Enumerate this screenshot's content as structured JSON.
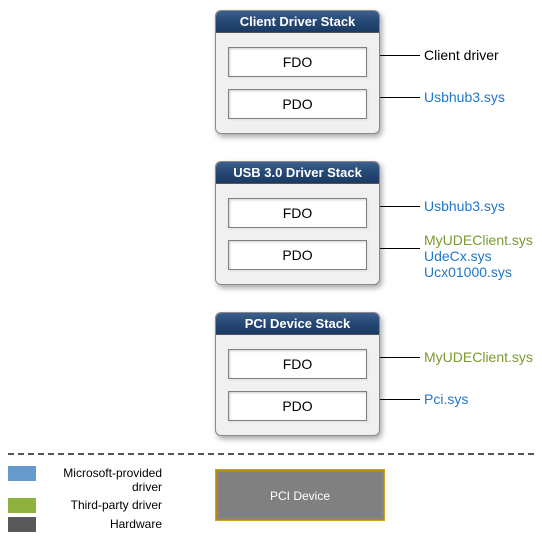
{
  "stacks": [
    {
      "title": "Client Driver Stack",
      "fdo": "FDO",
      "pdo": "PDO",
      "fdo_labels": [
        {
          "text": "Client driver",
          "cls": "c-black"
        }
      ],
      "pdo_labels": [
        {
          "text": "Usbhub3.sys",
          "cls": "c-blue"
        }
      ]
    },
    {
      "title": "USB 3.0 Driver Stack",
      "fdo": "FDO",
      "pdo": "PDO",
      "fdo_labels": [
        {
          "text": "Usbhub3.sys",
          "cls": "c-blue"
        }
      ],
      "pdo_labels": [
        {
          "text": "MyUDEClient.sys",
          "cls": "c-green"
        },
        {
          "text": "UdeCx.sys",
          "cls": "c-blue"
        },
        {
          "text": "Ucx01000.sys",
          "cls": "c-blue"
        }
      ]
    },
    {
      "title": "PCI Device Stack",
      "fdo": "FDO",
      "pdo": "PDO",
      "fdo_labels": [
        {
          "text": "MyUDEClient.sys",
          "cls": "c-green"
        }
      ],
      "pdo_labels": [
        {
          "text": "Pci.sys",
          "cls": "c-blue"
        }
      ]
    }
  ],
  "legend": {
    "row1": "Microsoft-provided driver",
    "row2": "Third-party driver",
    "row3": "Hardware"
  },
  "device": "PCI Device"
}
